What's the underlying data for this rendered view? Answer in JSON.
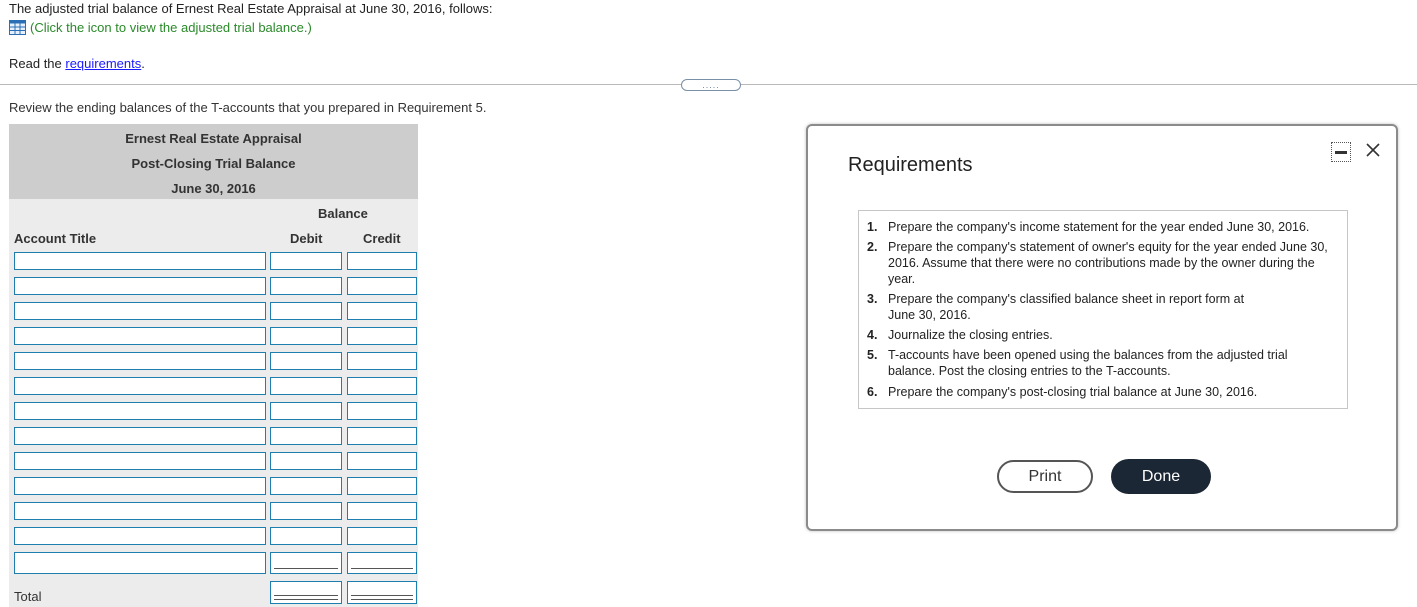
{
  "intro": {
    "text": "The adjusted trial balance of Ernest Real Estate Appraisal at June 30, 2016, follows:",
    "click_text": "(Click the icon to view the adjusted trial balance.)",
    "read_prefix": "Read the ",
    "read_link": "requirements",
    "read_suffix": "."
  },
  "divider": {
    "handle_text": "....."
  },
  "review_text": "Review the ending balances of the T-accounts that you prepared in Requirement 5.",
  "trial_balance": {
    "company": "Ernest Real Estate Appraisal",
    "title": "Post-Closing Trial Balance",
    "date": "June 30, 2016",
    "balance_header": "Balance",
    "col_account": "Account Title",
    "col_debit": "Debit",
    "col_credit": "Credit",
    "total_label": "Total"
  },
  "modal": {
    "title": "Requirements",
    "requirements": [
      {
        "num": "1.",
        "text": "Prepare the company's income statement for the year ended June 30, 2016."
      },
      {
        "num": "2.",
        "text": "Prepare the company's statement of owner's equity for the year ended June 30, 2016. Assume that there were no contributions made by the owner during the year."
      },
      {
        "num": "3.",
        "text": "Prepare the company's classified balance sheet in report form at June 30, 2016."
      },
      {
        "num": "4.",
        "text": "Journalize the closing entries."
      },
      {
        "num": "5.",
        "text": "T-accounts have been opened using the balances from the adjusted trial balance. Post the closing entries to the T-accounts."
      },
      {
        "num": "6.",
        "text": "Prepare the company's post-closing trial balance at June 30, 2016."
      }
    ],
    "print_label": "Print",
    "done_label": "Done"
  },
  "colors": {
    "link": "#1a1aff",
    "click_text": "#2a8a2a",
    "input_border": "#1e7fae",
    "header_bg": "#cdcdcd",
    "done_bg": "#1c2735"
  }
}
